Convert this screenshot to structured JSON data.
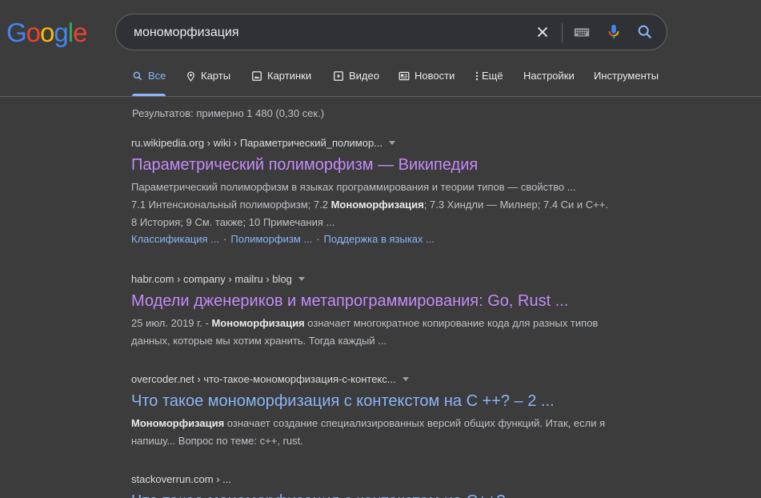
{
  "logo": {
    "letters": [
      "G",
      "o",
      "o",
      "g",
      "l",
      "e"
    ],
    "colors": [
      "#4285f4",
      "#ea4335",
      "#fbbc05",
      "#4285f4",
      "#34a853",
      "#ea4335"
    ]
  },
  "search": {
    "query": "мономорфизация",
    "icons": [
      "close-icon",
      "keyboard-icon",
      "microphone-icon",
      "search-icon"
    ]
  },
  "tabs": [
    {
      "label": "Все",
      "icon": "search-icon",
      "active": true
    },
    {
      "label": "Карты",
      "icon": "map-pin-icon"
    },
    {
      "label": "Картинки",
      "icon": "image-icon"
    },
    {
      "label": "Видео",
      "icon": "video-icon"
    },
    {
      "label": "Новости",
      "icon": "news-icon"
    },
    {
      "label": "Ещё",
      "icon": "more-vert-icon"
    },
    {
      "label": "Настройки"
    },
    {
      "label": "Инструменты"
    }
  ],
  "stats": "Результатов: примерно 1 480 (0,30 сек.)",
  "results": [
    {
      "crumb": "ru.wikipedia.org › wiki › Параметрический_полимор...",
      "title": "Параметрический полиморфизм — Википедия",
      "visited": true,
      "snippet": [
        "Параметрический полиморфизм в языках программирования и теории типов — свойство ...",
        "7.1 Интенсиональный полиморфизм; 7.2 ",
        "Мономорфизация",
        "; 7.3 Хиндли — Милнер; 7.4 Си и C++. 8 История; 9 См. также; 10 Примечания ..."
      ],
      "sitelinks": [
        "Классификация ...",
        "Полиморфизм ...",
        "Поддержка в языках ..."
      ]
    },
    {
      "crumb": "habr.com › company › mailru › blog",
      "title": "Модели дженериков и метапрограммирования: Go, Rust ...",
      "visited": true,
      "snippet": [
        "25 июл. 2019 г. - ",
        "Мономорфизация",
        " означает многократное копирование кода для разных типов данных, которые мы хотим хранить. Тогда каждый ..."
      ]
    },
    {
      "crumb": "overcoder.net › что-такое-мономорфизация-с-контекс...",
      "title": "Что такое мономорфизация с контекстом на C ++? – 2 ...",
      "visited": false,
      "snippet": [
        "Мономорфизация",
        " означает создание специализированных версий общих функций. Итак, если я напишу... Вопрос по теме: c++, rust."
      ]
    },
    {
      "crumb": "stackoverrun.com › ...",
      "title": "Что такое мономорфизация с контекстом на C++?",
      "visited": false
    }
  ]
}
